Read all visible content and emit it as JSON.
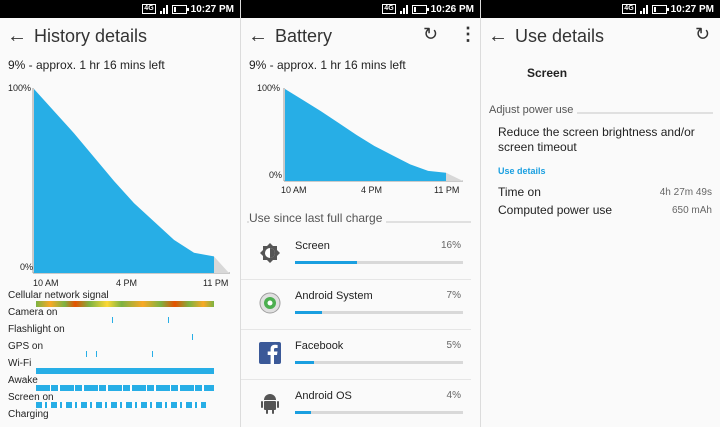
{
  "colors": {
    "accent": "#1aa0e0",
    "fill": "#27aee6",
    "link": "#1a9fe0"
  },
  "panel1": {
    "status_time": "10:27 PM",
    "network": "4G",
    "title": "History details",
    "summary": "9% - approx. 1 hr 16 mins left",
    "chart": {
      "y_top": "100%",
      "y_bottom": "0%",
      "x_labels": [
        "10 AM",
        "4 PM",
        "11 PM"
      ]
    },
    "signals": [
      {
        "label": "Cellular network signal"
      },
      {
        "label": "Camera on"
      },
      {
        "label": "Flashlight on"
      },
      {
        "label": "GPS on"
      },
      {
        "label": "Wi-Fi"
      },
      {
        "label": "Awake"
      },
      {
        "label": "Screen on"
      },
      {
        "label": "Charging"
      }
    ]
  },
  "panel2": {
    "status_time": "10:26 PM",
    "network": "4G",
    "title": "Battery",
    "summary": "9% - approx. 1 hr 16 mins left",
    "chart": {
      "y_top": "100%",
      "y_bottom": "0%",
      "x_labels": [
        "10 AM",
        "4 PM",
        "11 PM"
      ]
    },
    "section": "Use since last full charge",
    "apps": [
      {
        "name": "Screen",
        "pct": "16%",
        "value": 16,
        "icon": "screen-brightness-icon"
      },
      {
        "name": "Android System",
        "pct": "7%",
        "value": 7,
        "icon": "android-system-icon"
      },
      {
        "name": "Facebook",
        "pct": "5%",
        "value": 5,
        "icon": "facebook-icon"
      },
      {
        "name": "Android OS",
        "pct": "4%",
        "value": 4,
        "icon": "android-os-icon"
      }
    ]
  },
  "panel3": {
    "status_time": "10:27 PM",
    "network": "4G",
    "title": "Use details",
    "app_name": "Screen",
    "adjust_header": "Adjust power use",
    "adjust_text": "Reduce the screen brightness and/or screen timeout",
    "use_details_header": "Use details",
    "rows": [
      {
        "label": "Time on",
        "value": "4h 27m 49s"
      },
      {
        "label": "Computed power use",
        "value": "650 mAh"
      }
    ]
  },
  "chart_data": {
    "type": "area",
    "x": [
      "10 AM",
      "4 PM",
      "11 PM"
    ],
    "ylim": [
      0,
      100
    ],
    "series": [
      {
        "values": [
          100,
          88,
          76,
          63,
          50,
          38,
          28,
          18,
          11,
          9
        ]
      }
    ]
  }
}
